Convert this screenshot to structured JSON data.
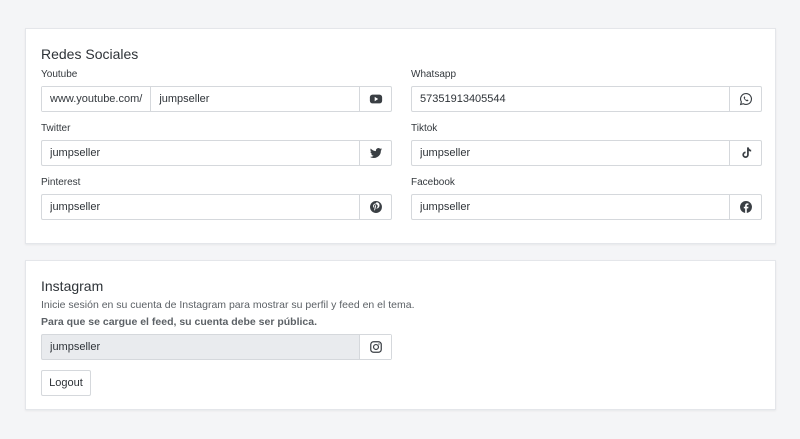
{
  "social": {
    "title": "Redes Sociales",
    "fields": {
      "youtube": {
        "label": "Youtube",
        "prefix": "www.youtube.com/",
        "value": "jumpseller",
        "icon": "youtube-icon"
      },
      "whatsapp": {
        "label": "Whatsapp",
        "value": "57351913405544",
        "icon": "whatsapp-icon"
      },
      "twitter": {
        "label": "Twitter",
        "value": "jumpseller",
        "icon": "twitter-icon"
      },
      "tiktok": {
        "label": "Tiktok",
        "value": "jumpseller",
        "icon": "tiktok-icon"
      },
      "pinterest": {
        "label": "Pinterest",
        "value": "jumpseller",
        "icon": "pinterest-icon"
      },
      "facebook": {
        "label": "Facebook",
        "value": "jumpseller",
        "icon": "facebook-icon"
      }
    }
  },
  "instagram": {
    "title": "Instagram",
    "description": "Inicie sesión en su cuenta de Instagram para mostrar su perfil y feed en el tema.",
    "note": "Para que se cargue el feed, su cuenta debe ser pública.",
    "value": "jumpseller",
    "icon": "instagram-icon",
    "logout_label": "Logout"
  },
  "colors": {
    "icon": "#3a3f44",
    "border": "#d5d8dc",
    "disabled_bg": "#e9ebee"
  }
}
